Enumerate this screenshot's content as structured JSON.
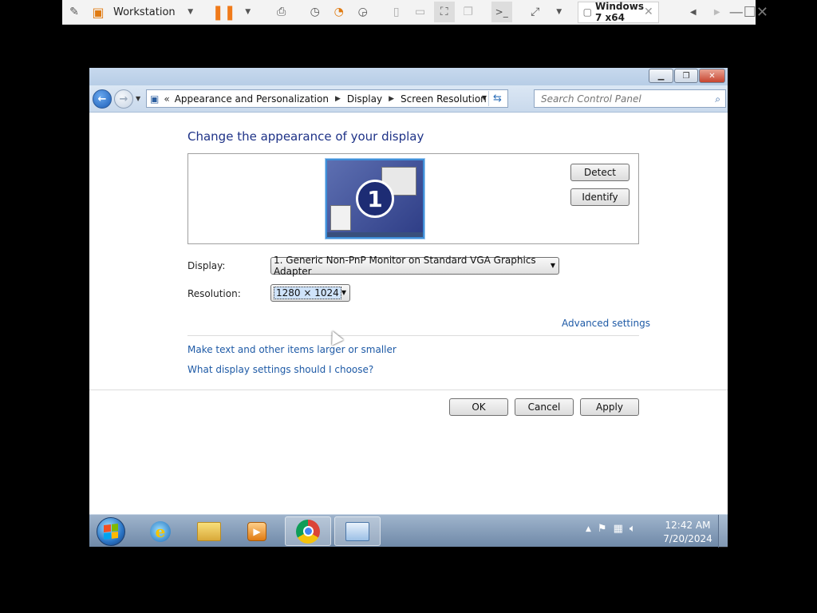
{
  "vm_toolbar": {
    "workstation_label": "Workstation",
    "tab_title": "Windows 7 x64"
  },
  "explorer": {
    "breadcrumb": [
      "Appearance and Personalization",
      "Display",
      "Screen Resolution"
    ],
    "search_placeholder": "Search Control Panel"
  },
  "screen_resolution": {
    "title": "Change the appearance of your display",
    "monitor_number": "1",
    "detect_label": "Detect",
    "identify_label": "Identify",
    "display_label": "Display:",
    "display_value": "1. Generic Non-PnP Monitor on Standard VGA Graphics Adapter",
    "resolution_label": "Resolution:",
    "resolution_value": "1280 × 1024",
    "advanced_link": "Advanced settings",
    "link_text_size": "Make text and other items larger or smaller",
    "link_help": "What display settings should I choose?",
    "ok_label": "OK",
    "cancel_label": "Cancel",
    "apply_label": "Apply"
  },
  "taskbar": {
    "apps": [
      "internet-explorer",
      "windows-explorer",
      "media-player",
      "chrome",
      "control-panel"
    ],
    "time": "12:42 AM",
    "date": "7/20/2024"
  },
  "colors": {
    "title_blue": "#1e3287",
    "link_blue": "#1e5aa6"
  }
}
